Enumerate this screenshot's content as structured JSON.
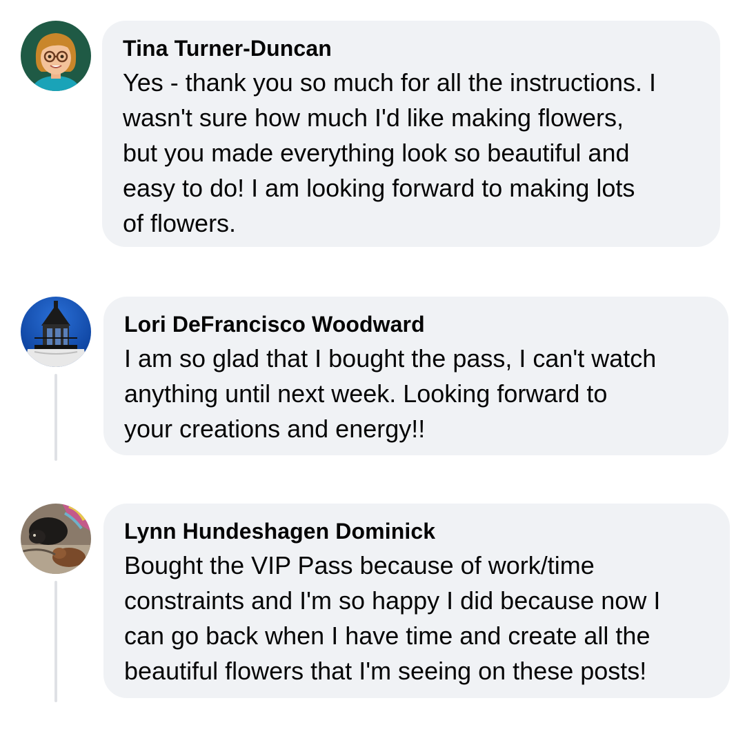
{
  "comments": [
    {
      "author": "Tina Turner-Duncan",
      "text": "Yes - thank you so much for all the instructions. I\nwasn't sure how much I'd like making flowers,\nbut you made everything look so beautiful and\neasy to do!  I am looking forward to making lots\nof flowers.",
      "avatar_icon": "cartoon-woman-avatar-icon"
    },
    {
      "author": "Lori DeFrancisco Woodward",
      "text": "I am so glad that I bought the pass, I can't watch\nanything until next week.  Looking forward to\nyour creations and energy!!",
      "avatar_icon": "lighthouse-avatar-icon"
    },
    {
      "author": "Lynn Hundeshagen Dominick",
      "text": "Bought the VIP Pass because of work/time\nconstraints and I'm so happy I did because now I\ncan go back when I have time and create all the\nbeautiful flowers that I'm seeing on these posts!",
      "avatar_icon": "dog-photo-avatar-icon"
    }
  ],
  "colors": {
    "bubble": "#f0f2f5",
    "thread_line": "#dfe1e5",
    "text": "#050505"
  }
}
